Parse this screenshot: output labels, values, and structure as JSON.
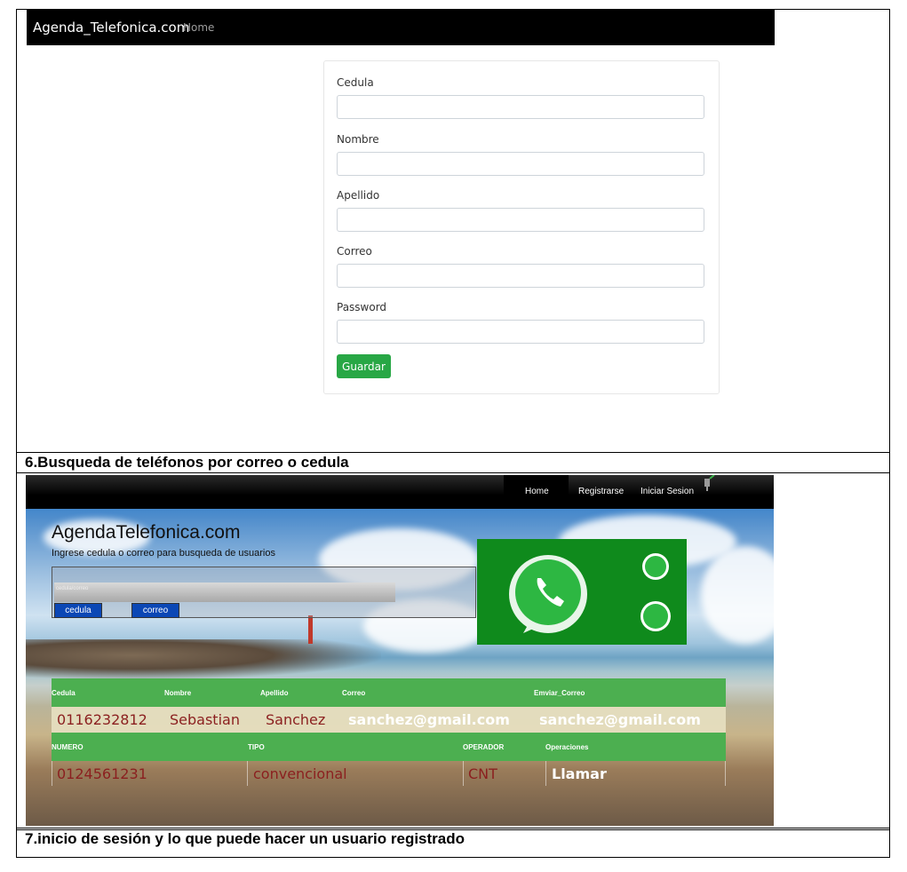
{
  "register": {
    "brand": "Agenda_Telefonica.com",
    "home": "Home",
    "fields": [
      {
        "label": "Cedula"
      },
      {
        "label": "Nombre"
      },
      {
        "label": "Apellido"
      },
      {
        "label": "Correo"
      },
      {
        "label": "Password"
      }
    ],
    "submit": "Guardar"
  },
  "caption6": "6.Busqueda de teléfonos por correo o cedula",
  "search_page": {
    "nav": {
      "home": "Home",
      "register": "Registrarse",
      "login": "Iniciar Sesion"
    },
    "title": "AgendaTelefonica.com",
    "subtitle": "Ingrese cedula o correo para busqueda de usuarios",
    "input_placeholder": "cedula/correo",
    "btn_cedula": "cedula",
    "btn_correo": "correo",
    "table": {
      "headers1": [
        "Cedula",
        "Nombre",
        "Apellido",
        "Correo",
        "Emviar_Correo"
      ],
      "row1": [
        "0116232812",
        "Sebastian",
        "Sanchez",
        "sanchez@gmail.com",
        "sanchez@gmail.com"
      ],
      "headers2": [
        "NUMERO",
        "TIPO",
        "OPERADOR",
        "Operaciones"
      ],
      "row2": [
        "0124561231",
        "convencional",
        "CNT",
        "Llamar"
      ]
    },
    "colors": {
      "header_green": "#4caf50",
      "button_blue": "#0b47b5",
      "whatsapp_green": "#0f8a1c"
    }
  },
  "caption7": "7.inicio de sesión y lo que puede hacer un usuario registrado"
}
